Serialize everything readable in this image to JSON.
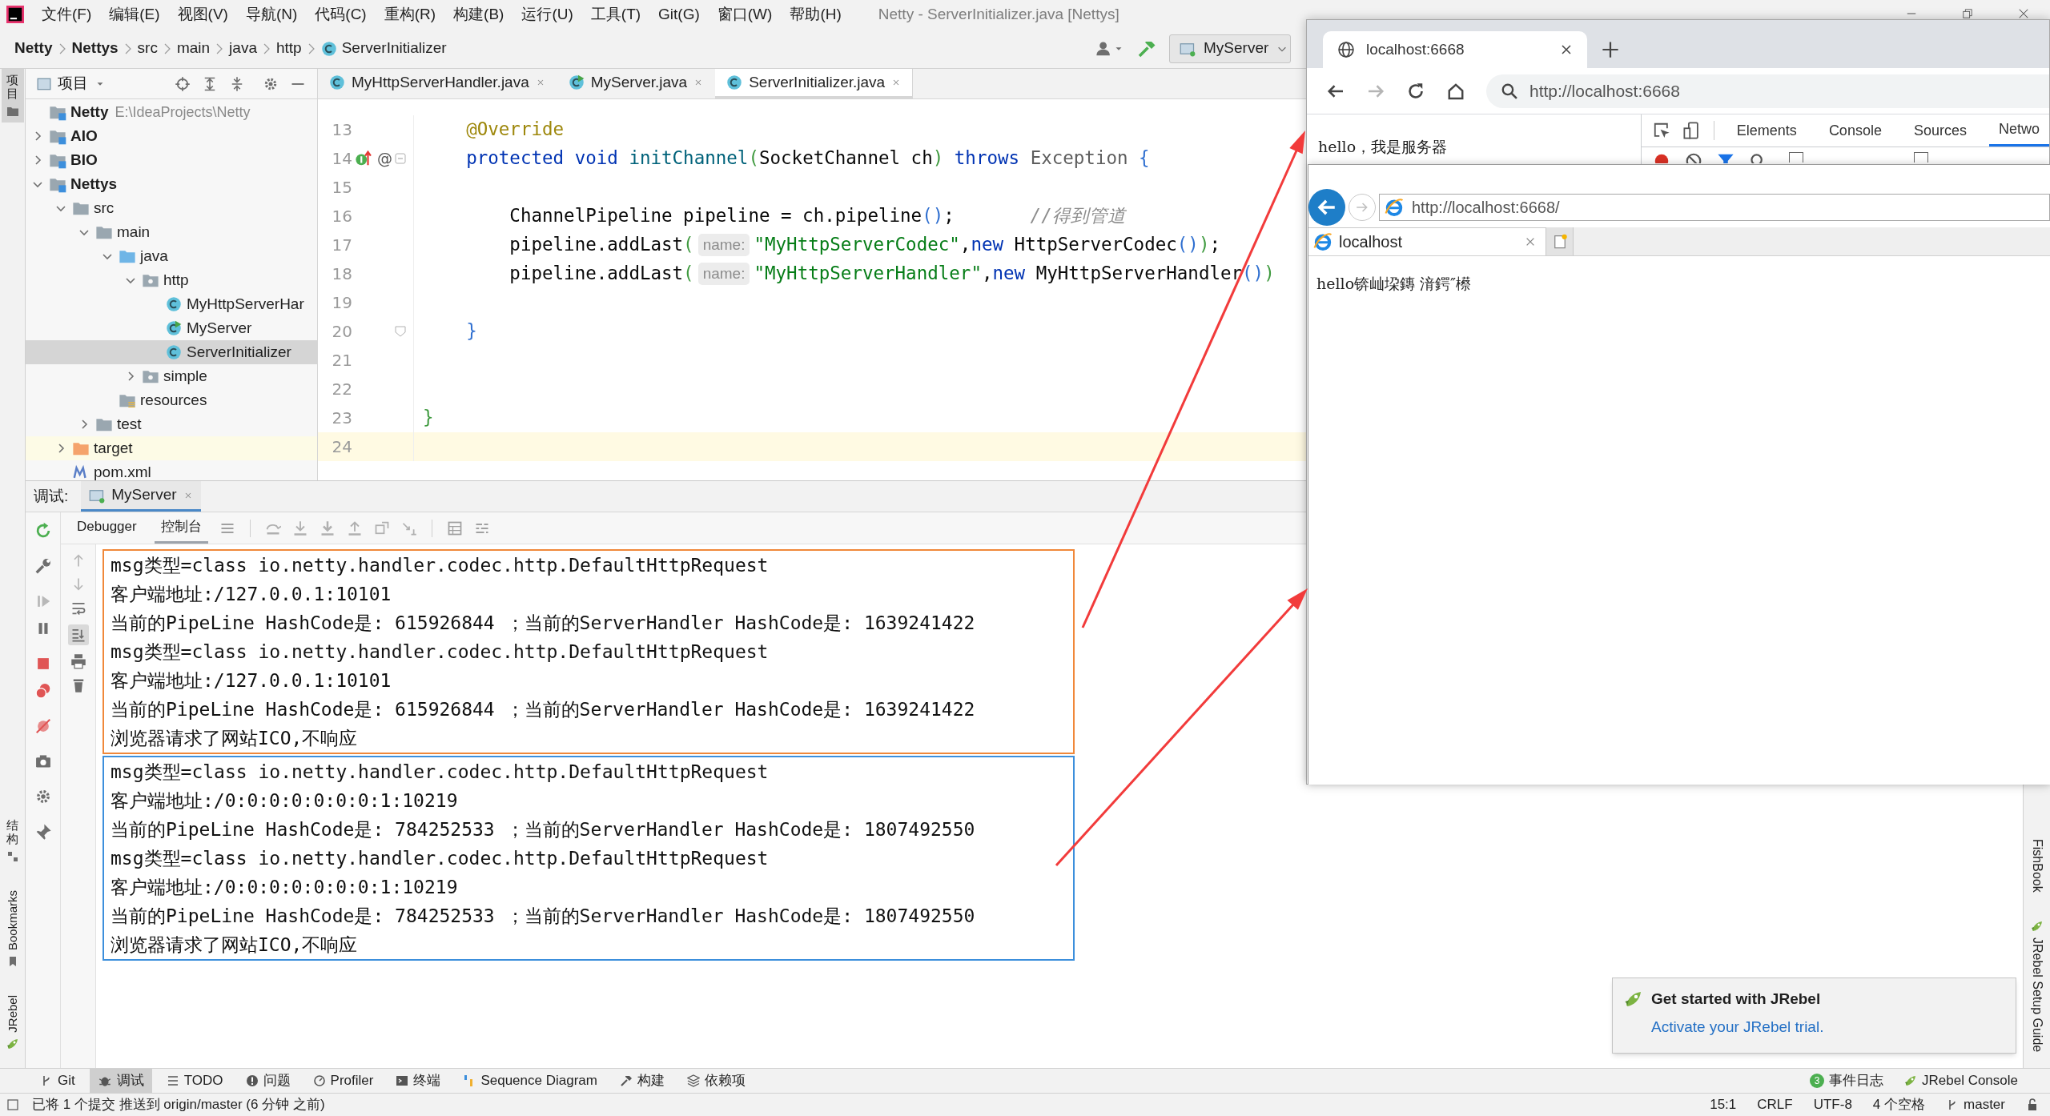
{
  "title_bar": {
    "menu": [
      "文件(F)",
      "编辑(E)",
      "视图(V)",
      "导航(N)",
      "代码(C)",
      "重构(R)",
      "构建(B)",
      "运行(U)",
      "工具(T)",
      "Git(G)",
      "窗口(W)",
      "帮助(H)"
    ],
    "title": "Netty - ServerInitializer.java [Nettys]"
  },
  "navigation_bar": {
    "breadcrumbs": [
      {
        "label": "Netty",
        "kind": "project"
      },
      {
        "label": "Nettys",
        "kind": "module"
      },
      {
        "label": "src",
        "kind": "folder"
      },
      {
        "label": "main",
        "kind": "folder"
      },
      {
        "label": "java",
        "kind": "folder"
      },
      {
        "label": "http",
        "kind": "folder"
      },
      {
        "label": "ServerInitializer",
        "kind": "class"
      }
    ],
    "run_configuration": "MyServer"
  },
  "left_strip": {
    "top": [
      {
        "label": "项目",
        "selected": true
      }
    ],
    "bottom": [
      {
        "label": "结构",
        "selected": false
      },
      {
        "label": "Bookmarks",
        "selected": false
      },
      {
        "label": "JRebel",
        "selected": false
      }
    ]
  },
  "right_strip": [
    {
      "label": "FishBook",
      "kind": "plain"
    },
    {
      "label": "JRebel Setup Guide",
      "kind": "jrebel"
    }
  ],
  "project_panel": {
    "title": "项目",
    "tree": [
      {
        "label": "Netty",
        "path": "E:\\IdeaProjects\\Netty",
        "kind": "project",
        "selected": false,
        "children": [
          {
            "label": "AIO",
            "kind": "module",
            "expanded": false,
            "selected": false
          },
          {
            "label": "BIO",
            "kind": "module",
            "expanded": false,
            "selected": false
          },
          {
            "label": "Nettys",
            "kind": "module",
            "expanded": true,
            "selected": false,
            "children": [
              {
                "label": "src",
                "kind": "folder",
                "expanded": true,
                "selected": false,
                "children": [
                  {
                    "label": "main",
                    "kind": "folder",
                    "expanded": true,
                    "selected": false,
                    "children": [
                      {
                        "label": "java",
                        "kind": "source",
                        "expanded": true,
                        "selected": false,
                        "children": [
                          {
                            "label": "http",
                            "kind": "package",
                            "expanded": true,
                            "selected": false,
                            "children": [
                              {
                                "label": "MyHttpServerHar",
                                "kind": "class",
                                "selected": false
                              },
                              {
                                "label": "MyServer",
                                "kind": "main_class",
                                "selected": false
                              },
                              {
                                "label": "ServerInitializer",
                                "kind": "class",
                                "selected": true
                              }
                            ]
                          },
                          {
                            "label": "simple",
                            "kind": "package",
                            "expanded": false,
                            "selected": false
                          }
                        ]
                      },
                      {
                        "label": "resources",
                        "kind": "resources",
                        "selected": false
                      }
                    ]
                  },
                  {
                    "label": "test",
                    "kind": "folder",
                    "expanded": false,
                    "selected": false
                  }
                ]
              },
              {
                "label": "target",
                "kind": "excluded",
                "expanded": false,
                "selected": false
              },
              {
                "label": "pom.xml",
                "kind": "maven",
                "selected": false
              }
            ]
          }
        ]
      }
    ]
  },
  "editor": {
    "tabs": [
      {
        "label": "MyHttpServerHandler.java",
        "kind": "class",
        "selected": false
      },
      {
        "label": "MyServer.java",
        "kind": "main_class",
        "selected": false
      },
      {
        "label": "ServerInitializer.java",
        "kind": "class",
        "selected": true
      }
    ],
    "lines": [
      {
        "number": "13",
        "current": false,
        "segments": [
          {
            "kind": "annotation",
            "text": "    @Override"
          }
        ]
      },
      {
        "number": "14",
        "current": false,
        "gutter_marks": [
          {
            "kind": "implements"
          },
          {
            "kind": "text",
            "text": "@"
          }
        ],
        "fold_marker": {
          "kind": "start"
        },
        "segments": [
          {
            "kind": "keyword",
            "text": "    protected void "
          },
          {
            "kind": "method",
            "text": "initChannel"
          },
          {
            "kind": "bracket1",
            "text": "("
          },
          {
            "kind": "plain",
            "text": "SocketChannel ch"
          },
          {
            "kind": "bracket1",
            "text": ")"
          },
          {
            "kind": "keyword",
            "text": " throws "
          },
          {
            "kind": "muted",
            "text": "Exception "
          },
          {
            "kind": "bracket2",
            "text": "{"
          }
        ]
      },
      {
        "number": "15",
        "current": false
      },
      {
        "number": "16",
        "current": false,
        "segments": [
          {
            "kind": "plain",
            "text": "        ChannelPipeline pipeline = ch.pipeline"
          },
          {
            "kind": "bracket2",
            "text": "()"
          },
          {
            "kind": "plain",
            "text": ";       "
          },
          {
            "kind": "comment",
            "text": "//得到管道"
          }
        ]
      },
      {
        "number": "17",
        "current": false,
        "segments": [
          {
            "kind": "plain",
            "text": "        pipeline.addLast"
          },
          {
            "kind": "bracket1",
            "text": "("
          },
          {
            "kind": "hint",
            "text": "name:"
          },
          {
            "kind": "string",
            "text": "\"MyHttpServerCodec\""
          },
          {
            "kind": "plain",
            "text": ","
          },
          {
            "kind": "keyword",
            "text": "new "
          },
          {
            "kind": "plain",
            "text": "HttpServerCodec"
          },
          {
            "kind": "bracket2",
            "text": "()"
          },
          {
            "kind": "bracket1",
            "text": ")"
          },
          {
            "kind": "plain",
            "text": ";"
          }
        ]
      },
      {
        "number": "18",
        "current": false,
        "segments": [
          {
            "kind": "plain",
            "text": "        pipeline.addLast"
          },
          {
            "kind": "bracket1",
            "text": "("
          },
          {
            "kind": "hint",
            "text": "name:"
          },
          {
            "kind": "string",
            "text": "\"MyHttpServerHandler\""
          },
          {
            "kind": "plain",
            "text": ","
          },
          {
            "kind": "keyword",
            "text": "new "
          },
          {
            "kind": "plain",
            "text": "MyHttpServerHandler"
          },
          {
            "kind": "bracket2",
            "text": "()"
          },
          {
            "kind": "bracket1",
            "text": ")"
          }
        ]
      },
      {
        "number": "19",
        "current": false
      },
      {
        "number": "20",
        "current": false,
        "fold_marker": {
          "kind": "end"
        },
        "segments": [
          {
            "kind": "bracket2",
            "text": "    }"
          }
        ]
      },
      {
        "number": "21",
        "current": false
      },
      {
        "number": "22",
        "current": false
      },
      {
        "number": "23",
        "current": false,
        "segments": [
          {
            "kind": "bracket1",
            "text": "}"
          }
        ]
      },
      {
        "number": "24",
        "current": true
      }
    ]
  },
  "debug_panel": {
    "label": "调试:",
    "tabs": [
      {
        "label": "MyServer",
        "selected": true
      }
    ],
    "sub_tabs": [
      {
        "label": "Debugger",
        "selected": false
      },
      {
        "label": "控制台",
        "selected": true
      }
    ]
  },
  "console": {
    "groups": [
      {
        "color": "#f0883a",
        "lines": [
          "msg类型=class io.netty.handler.codec.http.DefaultHttpRequest",
          "客户端地址:/127.0.0.1:10101",
          "当前的PipeLine HashCode是: 615926844 ；当前的ServerHandler HashCode是: 1639241422",
          "msg类型=class io.netty.handler.codec.http.DefaultHttpRequest",
          "客户端地址:/127.0.0.1:10101",
          "当前的PipeLine HashCode是: 615926844 ；当前的ServerHandler HashCode是: 1639241422",
          "浏览器请求了网站ICO,不响应"
        ]
      },
      {
        "color": "#3c8fdc",
        "lines": [
          "msg类型=class io.netty.handler.codec.http.DefaultHttpRequest",
          "客户端地址:/0:0:0:0:0:0:0:1:10219",
          "当前的PipeLine HashCode是: 784252533 ；当前的ServerHandler HashCode是: 1807492550",
          "msg类型=class io.netty.handler.codec.http.DefaultHttpRequest",
          "客户端地址:/0:0:0:0:0:0:0:1:10219",
          "当前的PipeLine HashCode是: 784252533 ；当前的ServerHandler HashCode是: 1807492550",
          "浏览器请求了网站ICO,不响应"
        ]
      }
    ]
  },
  "tool_window_bar": {
    "left": [
      {
        "label": "Git",
        "kind": "git",
        "selected": false
      },
      {
        "label": "调试",
        "kind": "debug",
        "selected": true
      },
      {
        "label": "TODO",
        "kind": "todo",
        "selected": false
      },
      {
        "label": "问题",
        "kind": "problems",
        "selected": false
      },
      {
        "label": "Profiler",
        "kind": "profiler",
        "selected": false
      },
      {
        "label": "终端",
        "kind": "terminal",
        "selected": false
      },
      {
        "label": "Sequence Diagram",
        "kind": "sequence",
        "selected": false
      },
      {
        "label": "构建",
        "kind": "build",
        "selected": false
      },
      {
        "label": "依赖项",
        "kind": "dependencies",
        "selected": false
      }
    ],
    "right": [
      {
        "label": "事件日志",
        "kind": "event_log",
        "badge": "3"
      },
      {
        "label": "JRebel Console",
        "kind": "jrebel"
      }
    ]
  },
  "status_bar": {
    "message": "已将 1 个提交 推送到 origin/master (6 分钟 之前)",
    "items": [
      "15:1",
      "CRLF",
      "UTF-8",
      "4 个空格"
    ],
    "branch": "master"
  },
  "notification": {
    "title": "Get started with JRebel",
    "link": "Activate your JRebel trial."
  },
  "chrome_window": {
    "tab_title": "localhost:6668",
    "url": "http://localhost:6668",
    "page_text": "hello，我是服务器",
    "devtools": {
      "tabs": [
        {
          "label": "Elements",
          "selected": false
        },
        {
          "label": "Console",
          "selected": false
        },
        {
          "label": "Sources",
          "selected": false
        },
        {
          "label": "Netwo",
          "selected": true
        }
      ],
      "checkboxes": [
        {
          "checked": false
        },
        {
          "checked": false
        }
      ]
    }
  },
  "ie_window": {
    "url": "http://localhost:6668/",
    "tab_title": "localhost",
    "page_text": "hello锛屾垜鏄 湇鍔″櫒"
  }
}
